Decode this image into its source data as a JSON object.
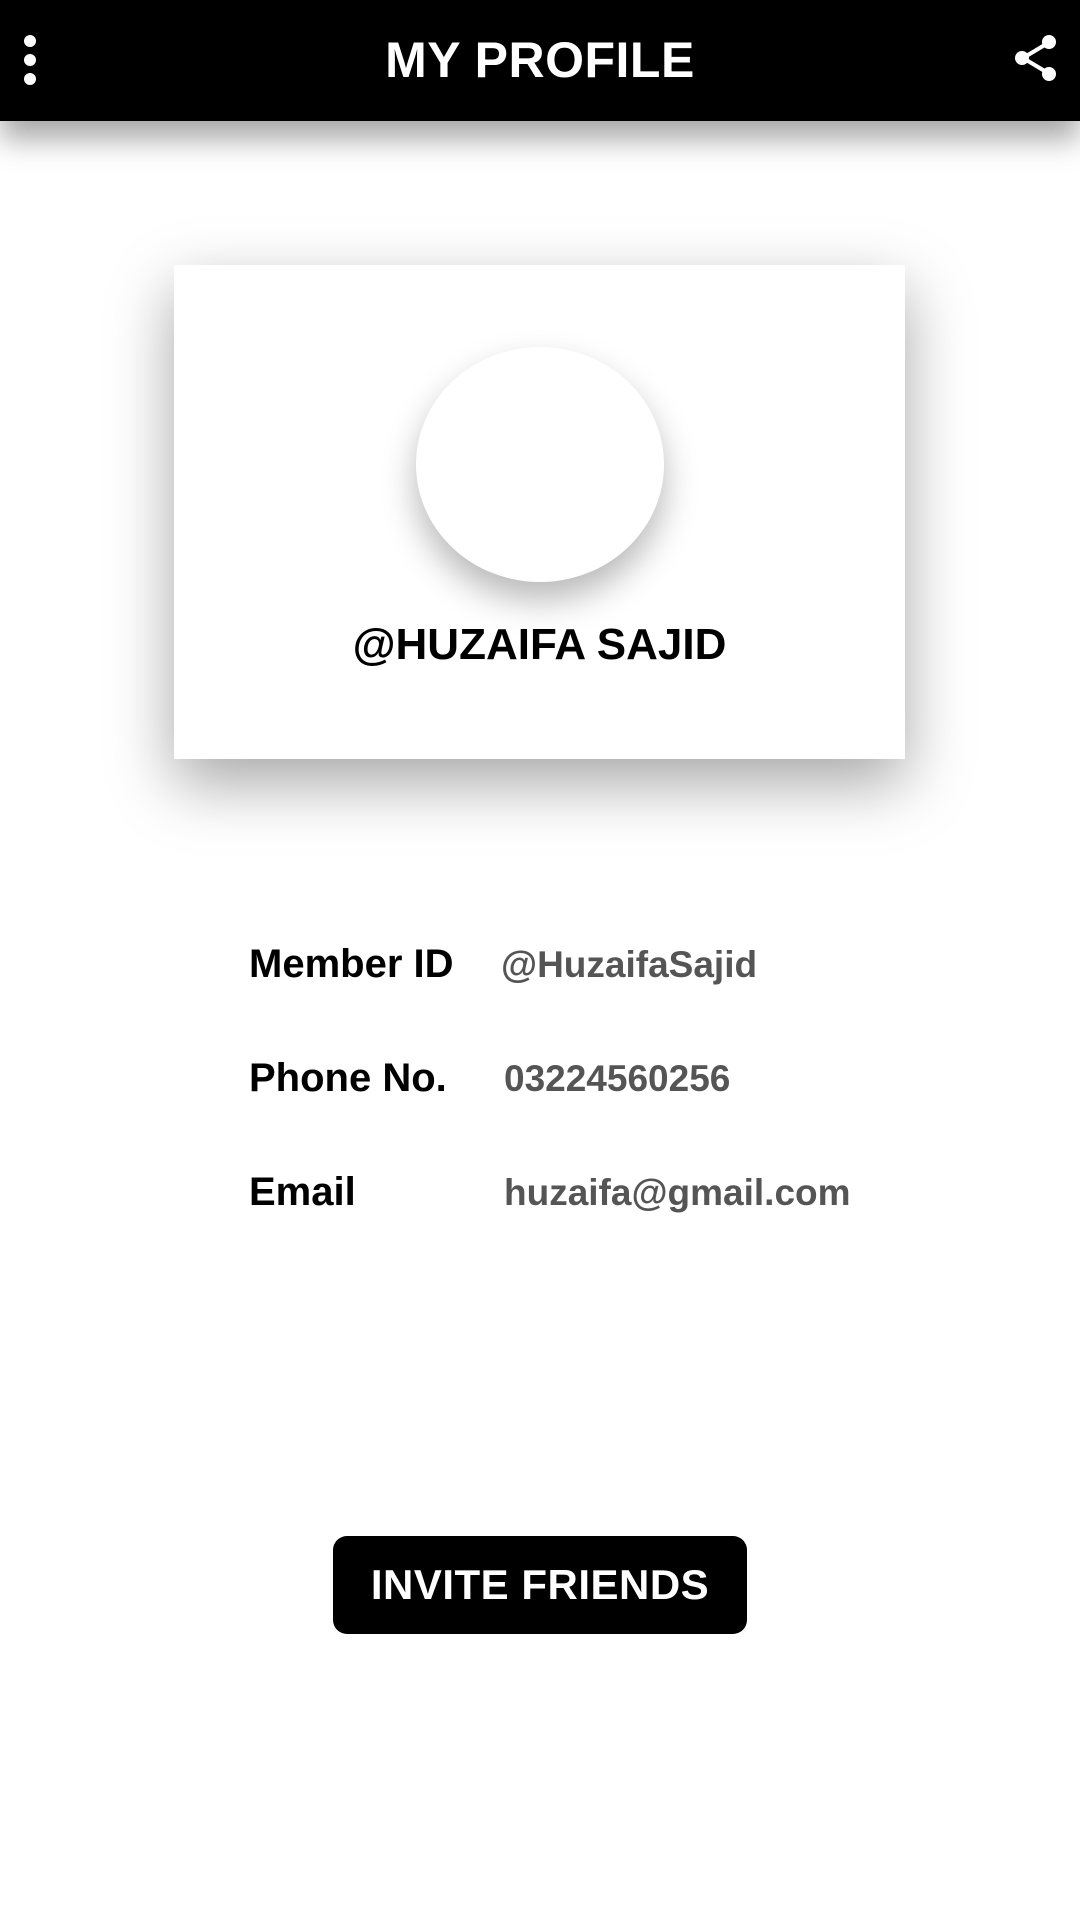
{
  "header": {
    "title": "MY PROFILE",
    "menu_icon": "more-vertical-icon",
    "share_icon": "share-icon",
    "background_color": "#000000",
    "text_color": "#ffffff"
  },
  "profile": {
    "name": "@HUZAIFA SAJID",
    "avatar_icon": "avatar-placeholder"
  },
  "details": {
    "member_id": {
      "label": "Member ID",
      "value": "@HuzaifaSajid"
    },
    "phone": {
      "label": "Phone No.",
      "value": "03224560256"
    },
    "email": {
      "label": "Email",
      "value": "huzaifa@gmail.com"
    }
  },
  "actions": {
    "invite_label": "INVITE FRIENDS"
  }
}
